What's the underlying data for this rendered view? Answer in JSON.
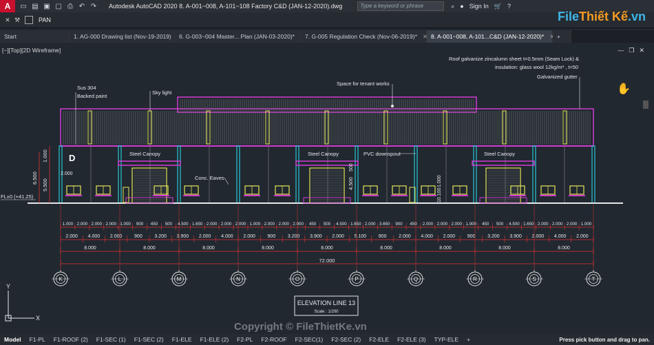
{
  "app": {
    "logo": "A",
    "title": "Autodesk AutoCAD 2020   8. A-001~008, A-101~108 Factory C&D (JAN-12-2020).dwg",
    "search_placeholder": "Type a keyword or phrase",
    "signin": "Sign In"
  },
  "command": {
    "text": "PAN"
  },
  "brand": {
    "part1": "File",
    "part2": "Thiết Kế",
    ".vn": ".vn",
    "suffix": ".vn"
  },
  "tabs": [
    {
      "label": "Start"
    },
    {
      "label": "1. AG-000 Drawing list (Nov-19-2019)"
    },
    {
      "label": "6. G-003~004 Master... Plan (JAN-03-2020)*"
    },
    {
      "label": "7. G-005 Regulation Check (Nov-06-2019)*"
    },
    {
      "label": "8. A-001~008, A-101...C&D (JAN-12-2020)*"
    }
  ],
  "viewport_label": "[−][Top][2D Wireframe]",
  "drawing": {
    "notes": {
      "roof_sheet": "Roof galvanize zincalumn sheet t=0.5mm (Seam Lock) &",
      "insulation": "insulation: glass wool 12kg/m³ , t=50",
      "gutter": "Galvanized gutter",
      "sus": "Sus 304",
      "backed": "Backed paint",
      "skylight": "Sky light",
      "tenant": "Space for tenant works",
      "canopy": "Steel Canopy",
      "eaves": "Conc. Eaves",
      "pvc": "PVC downspout",
      "grid_d": "D",
      "fl": "FL±0 (+41.25)"
    },
    "vertical_dims": [
      "6.500",
      "5.500",
      "1.000",
      "2.000",
      "4.500",
      "500",
      "1.000",
      "10.100"
    ],
    "dim_row1": [
      "1.000",
      "2.000",
      "2.000",
      "2.000",
      "1.000",
      "900",
      "450",
      "500",
      "4.500",
      "1.650",
      "2.000",
      "2.000",
      "2.000",
      "1.000",
      "2.000",
      "2.000",
      "2.000",
      "450",
      "500",
      "4.500",
      "1.650",
      "2.000",
      "3.650",
      "900",
      "450",
      "2.000",
      "2.000",
      "2.000",
      "1.000",
      "450",
      "500",
      "4.500",
      "1.650",
      "2.000",
      "2.000",
      "2.000",
      "1.000"
    ],
    "dim_row2": [
      "2.000",
      "4.000",
      "2.000",
      "900",
      "3.200",
      "3.900",
      "2.000",
      "4.000",
      "2.000",
      "900",
      "3.200",
      "3.900",
      "2.000",
      "5.100",
      "900",
      "2.000",
      "4.000",
      "2.000",
      "900",
      "3.200",
      "3.900",
      "2.000",
      "4.000",
      "2.000"
    ],
    "dim_row3": [
      "8.000",
      "8.000",
      "8.000",
      "8.000",
      "8.000",
      "8.000",
      "8.000",
      "8.000",
      "8.000"
    ],
    "total": "72.000",
    "grid_labels": [
      "K",
      "L",
      "M",
      "N",
      "O",
      "P",
      "Q",
      "R",
      "S",
      "T"
    ],
    "title": "ELEVATION LINE 13",
    "scale": "Scale : 1/200"
  },
  "watermark": "Copyright © FileThietKe.vn",
  "layout_tabs": [
    "Model",
    "F1-PL",
    "F1-ROOF (2)",
    "F1-SEC (1)",
    "F1-SEC (2)",
    "F1-ELE",
    "F1-ELE (2)",
    "F2-PL",
    "F2-ROOF",
    "F2-SEC(1)",
    "F2-SEC (2)",
    "F2-ELE",
    "F2-ELE (3)",
    "TYP-ELE",
    "+"
  ],
  "status": "Press pick button and drag to pan.",
  "colors": {
    "magenta": "#d23ad2",
    "cyan": "#27c7d6",
    "yellow": "#e6e657",
    "red": "#e03535",
    "white": "#e8e8e8"
  }
}
